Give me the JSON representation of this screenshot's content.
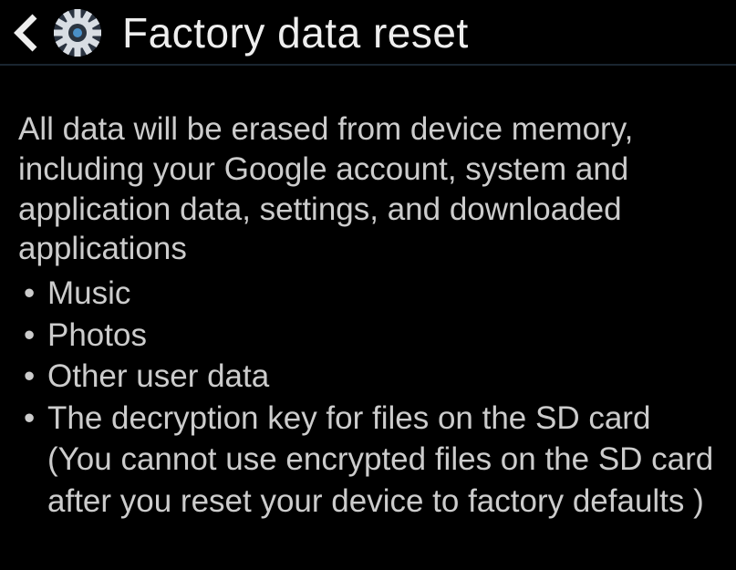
{
  "header": {
    "title": "Factory data reset"
  },
  "content": {
    "intro": "All data will be erased from device memory, including your Google account, system and application data, settings, and downloaded applications",
    "bullets": [
      {
        "text": "Music"
      },
      {
        "text": "Photos"
      },
      {
        "text": "Other user data"
      },
      {
        "text": "The decryption key for files on the SD card",
        "note": "(You cannot use encrypted files on the SD card after you reset your device to factory defaults )"
      }
    ]
  }
}
